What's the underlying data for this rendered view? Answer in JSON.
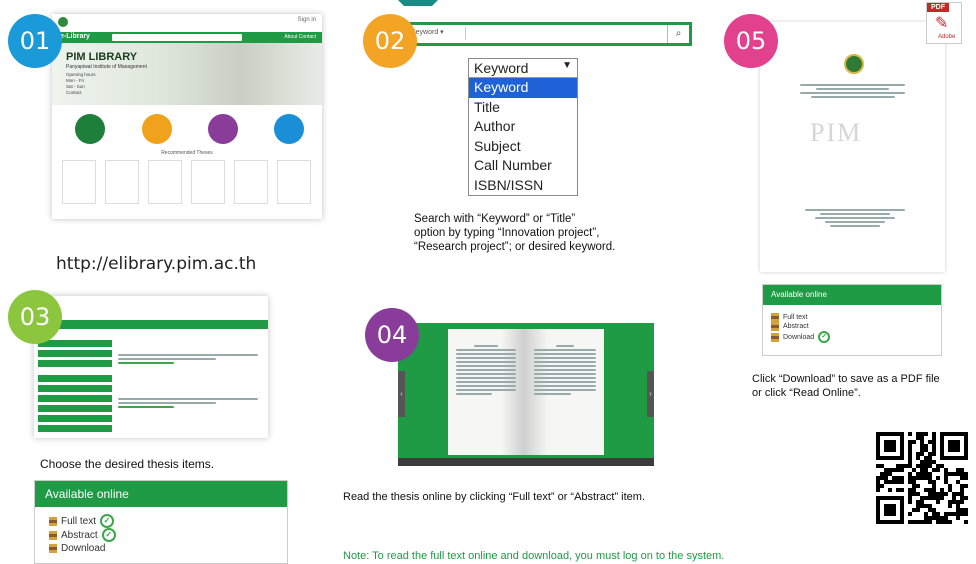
{
  "panel01": {
    "step": "01",
    "url": "http://elibrary.pim.ac.th",
    "header_link": "Sign in",
    "nav_title": "e-Library",
    "nav_links": "About   Contact",
    "hero_title": "PIM LIBRARY",
    "hero_subtitle": "Panyapiwat Institute of Management",
    "hero_lines": [
      "Opening hours",
      "Mon - Fri",
      "Sat - Sun",
      "Contact"
    ],
    "section_title": "Recommended Theses"
  },
  "panel02": {
    "step": "02",
    "search_value": "Keyword",
    "dropdown": {
      "selected": "Keyword",
      "options": [
        "Keyword",
        "Title",
        "Author",
        "Subject",
        "Call Number",
        "ISBN/ISSN"
      ]
    },
    "caption": [
      "Search with “Keyword” or “Title”",
      "option by typing “Innovation project”,",
      "“Research project”; or desired keyword."
    ]
  },
  "panel03": {
    "step": "03",
    "caption": "Choose the desired thesis items.",
    "available_title": "Available online",
    "links": [
      "Full text",
      "Abstract",
      "Download"
    ]
  },
  "panel04": {
    "step": "04",
    "caption": "Read the thesis online by clicking “Full text” or “Abstract” item.",
    "note": "Note: To read the full text online and download, you must log on to the system."
  },
  "panel05": {
    "step": "05",
    "pdf_label": "PDF",
    "pdf_sub": "Adobe",
    "watermark": "PIM",
    "available_title": "Available online",
    "links": [
      "Full text",
      "Abstract",
      "Download"
    ],
    "caption": [
      "Click “Download” to save as a PDF file",
      "or click “Read Online”."
    ]
  },
  "colors": {
    "green": "#1f9b46",
    "badge01": "#1a9ad9",
    "badge02": "#f4a425",
    "badge03": "#8cc63f",
    "badge04": "#8a3c9a",
    "badge05": "#e2418d",
    "note": "#1f9b46",
    "selected": "#1f62d8"
  }
}
